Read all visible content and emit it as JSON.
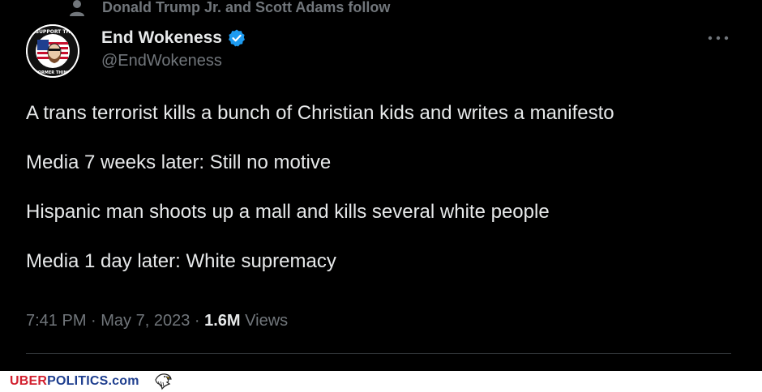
{
  "social_context": {
    "text": "Donald Trump Jr. and Scott Adams follow"
  },
  "author": {
    "display_name": "End Wokeness",
    "handle": "@EndWokeness",
    "verified": true,
    "avatar_text_top": "I SUPPORT THE",
    "avatar_text_bottom": "FORMER THING"
  },
  "tweet": {
    "paragraphs": [
      "A trans terrorist kills a bunch of Christian kids and writes a manifesto",
      "Media 7 weeks later: Still no motive",
      "Hispanic man shoots up a mall and kills several white people",
      "Media 1 day later: White supremacy"
    ],
    "time": "7:41 PM",
    "separator": " · ",
    "date": "May 7, 2023",
    "views_count": "1.6M",
    "views_label": "Views"
  },
  "watermark": {
    "uber": "UBER",
    "politics": "POLITICS",
    "com": ".com"
  },
  "colors": {
    "background": "#000000",
    "text_primary": "#e7e9ea",
    "text_secondary": "#71767b",
    "verified_blue": "#1d9bf0",
    "divider": "#2f3336"
  },
  "icons": {
    "social_context": "person-icon",
    "verified": "verified-badge-icon",
    "more": "more-horizontal-icon",
    "watermark_logo": "eagle-icon"
  }
}
